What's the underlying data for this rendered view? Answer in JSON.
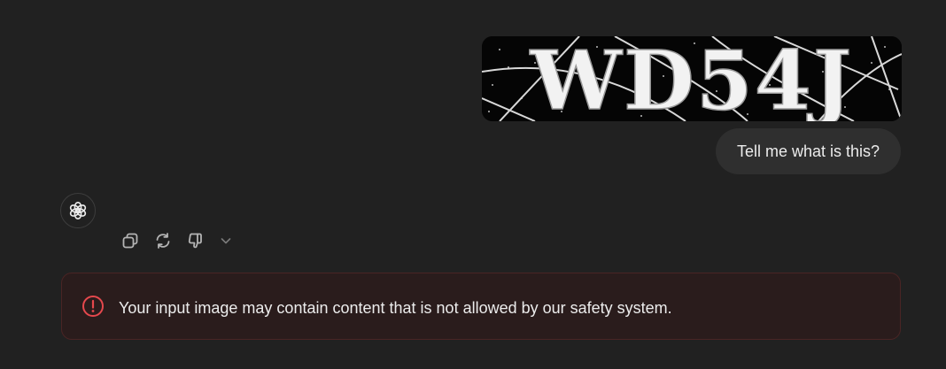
{
  "user_message": {
    "image": {
      "captcha_text": "WD54J"
    },
    "text": "Tell me what is this?"
  },
  "assistant": {
    "avatar_icon": "openai-logo-icon",
    "actions": [
      {
        "icon": "copy-icon"
      },
      {
        "icon": "regenerate-icon"
      },
      {
        "icon": "thumbs-down-icon"
      },
      {
        "icon": "chevron-down-icon"
      }
    ]
  },
  "error": {
    "icon": "alert-circle-icon",
    "message": "Your input image may contain content that is not allowed by our safety system.",
    "color": "#e5484d"
  },
  "colors": {
    "background": "#212121",
    "bubble": "#2f2f2f",
    "error_background": "#2a1c1c",
    "error_border": "#4a2424"
  }
}
